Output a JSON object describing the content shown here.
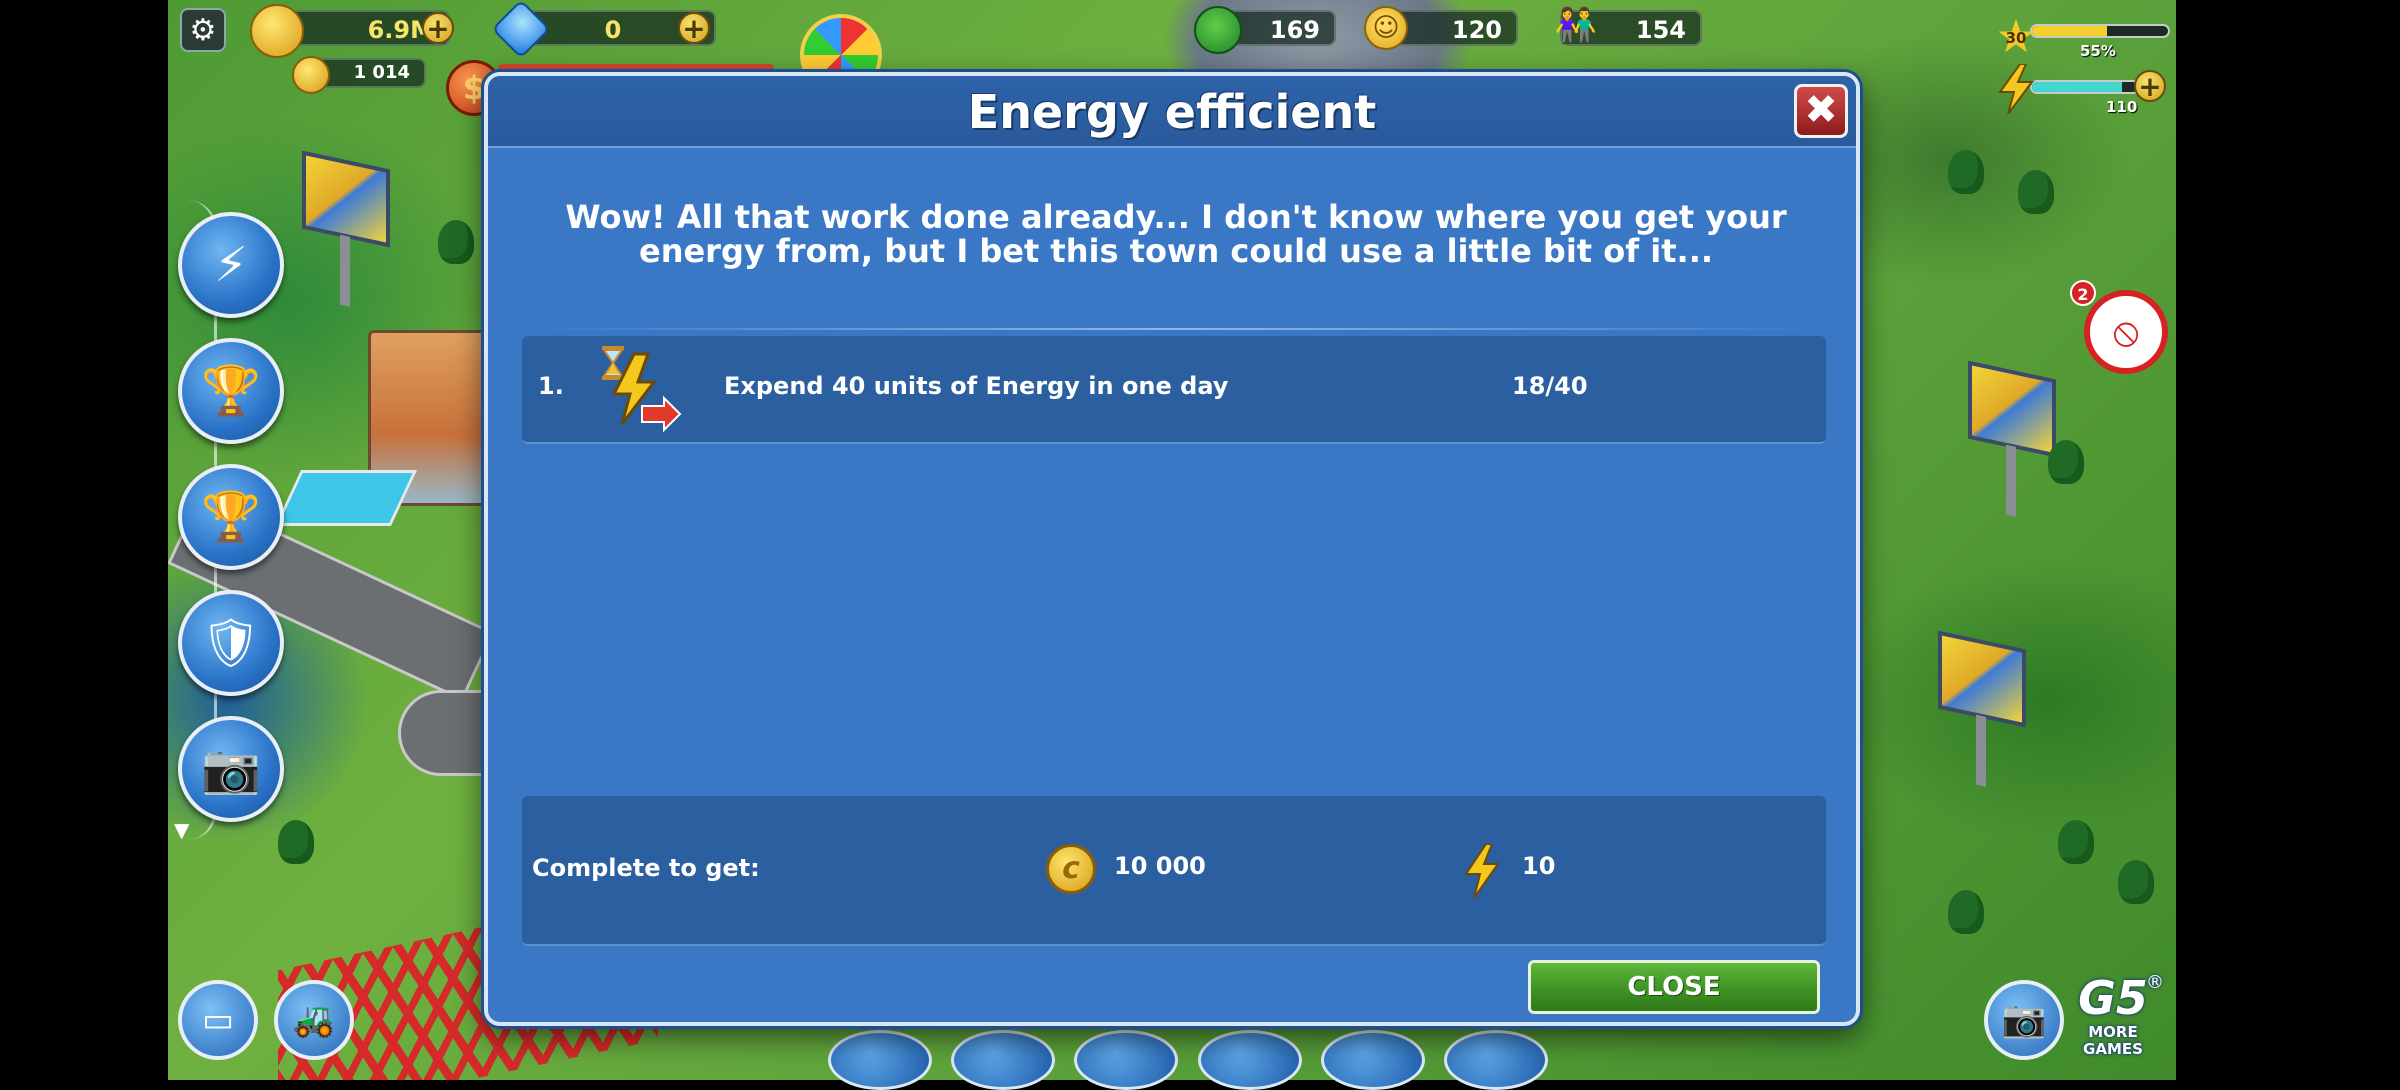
{
  "hud": {
    "coins": "6.9M",
    "cash_bonus": "1 014",
    "gems": "0",
    "trees": "169",
    "happiness": "120",
    "population": "154",
    "level": "30",
    "xp_percent_label": "55%",
    "xp_progress": 0.55,
    "energy_value": "110",
    "energy_progress": 0.85
  },
  "side_notification_count": "2",
  "dialog": {
    "title": "Energy efficient",
    "intro": "Wow! All that work done already... I don't know where you get your energy from, but I bet this town could use a little bit of it...",
    "tasks": [
      {
        "number": "1.",
        "text": "Expend 40 units of Energy in one day",
        "progress": "18/40"
      }
    ],
    "reward_label": "Complete to get:",
    "reward_coins": "10 000",
    "reward_energy": "10",
    "close_label": "CLOSE"
  },
  "g5": {
    "logo": "G5",
    "line1": "MORE",
    "line2": "GAMES"
  }
}
